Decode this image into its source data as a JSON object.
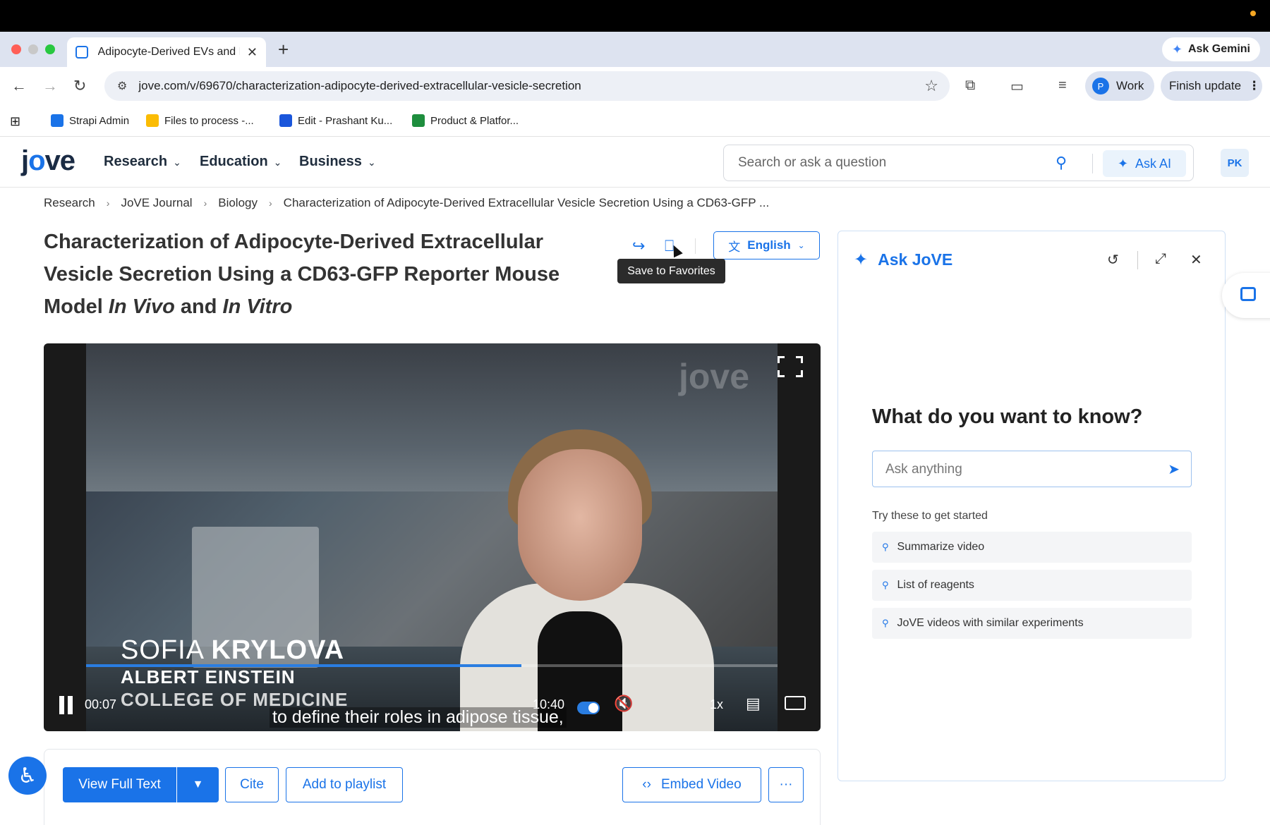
{
  "browser": {
    "tab_title": "Adipocyte-Derived EVs and P",
    "new_tab": "+",
    "tab_close": "✕",
    "ask_gemini": "Ask Gemini",
    "url": "jove.com/v/69670/characterization-adipocyte-derived-extracellular-vesicle-secretion",
    "profile_initial": "P",
    "profile_label": "Work",
    "finish_update": "Finish update",
    "bookmarks": [
      {
        "label": "Strapi Admin",
        "color": "#1a73e8"
      },
      {
        "label": "Files to process -...",
        "color": "#fbbc04"
      },
      {
        "label": "Edit - Prashant Ku...",
        "color": "#1a56db"
      },
      {
        "label": "Product & Platfor...",
        "color": "#1e8e3e"
      }
    ]
  },
  "site": {
    "logo_a": "j",
    "logo_b": "o",
    "logo_c": "ve",
    "nav": [
      {
        "label": "Research"
      },
      {
        "label": "Education"
      },
      {
        "label": "Business"
      }
    ],
    "search_placeholder": "Search or ask a question",
    "ask_ai": "Ask AI",
    "user_initials": "PK"
  },
  "breadcrumb": [
    "Research",
    "JoVE Journal",
    "Biology",
    "Characterization of Adipocyte-Derived Extracellular Vesicle Secretion Using a CD63-GFP ..."
  ],
  "article": {
    "title_part1": "Characterization of Adipocyte-Derived Extracellular Vesicle Secretion Using a CD63-GFP Reporter Mouse Model ",
    "title_italic1": "In Vivo",
    "title_part2": " and ",
    "title_italic2": "In Vitro",
    "language": "English",
    "tooltip": "Save to Favorites"
  },
  "video": {
    "watermark": "jove",
    "name_first": "SOFIA ",
    "name_last": "KRYLOVA",
    "affiliation_1": "ALBERT EINSTEIN",
    "affiliation_2": "COLLEGE OF MEDICINE",
    "caption": "to define their roles in adipose tissue,",
    "current_time": "00:07",
    "duration": "10:40",
    "speed": "1x",
    "progress": 0.63
  },
  "actions": {
    "view_full_text": "View Full Text",
    "cite": "Cite",
    "add_to_playlist": "Add to playlist",
    "embed_video": "Embed Video",
    "more": "···"
  },
  "ask_panel": {
    "title": "Ask JoVE",
    "question": "What do you want to know?",
    "input_placeholder": "Ask anything",
    "try_label": "Try these to get started",
    "suggestions": [
      "Summarize video",
      "List of reagents",
      "JoVE videos with similar experiments"
    ]
  },
  "colors": {
    "accent": "#1a73e8"
  }
}
